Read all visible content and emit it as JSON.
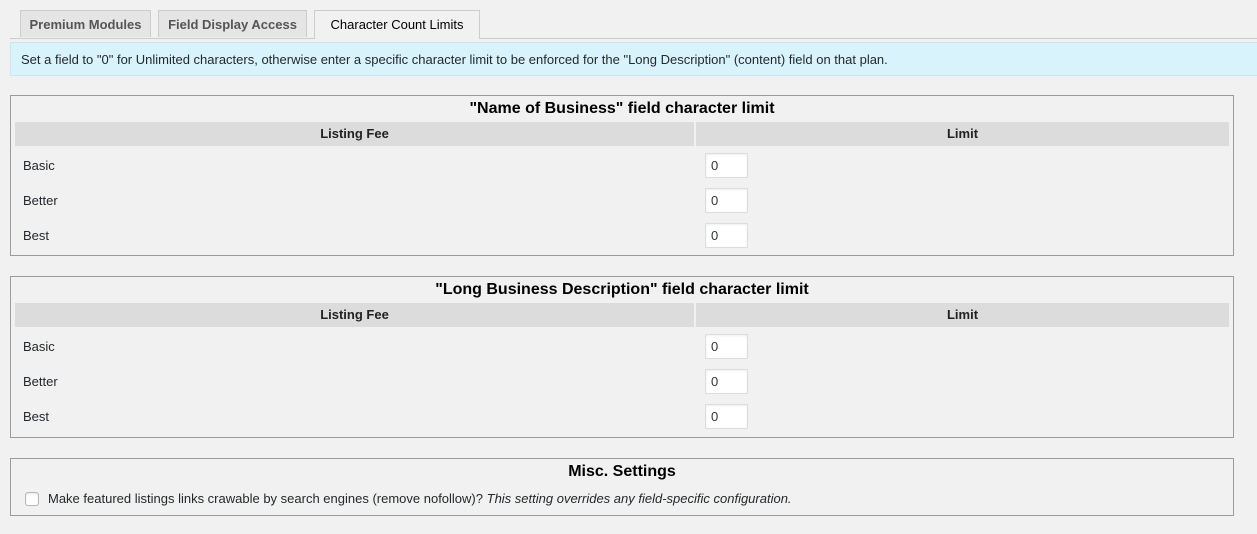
{
  "tabs": [
    {
      "label": "Premium Modules",
      "active": false
    },
    {
      "label": "Field Display Access",
      "active": false
    },
    {
      "label": "Character Count Limits",
      "active": true
    }
  ],
  "notice": {
    "text": "Set a field to \"0\" for Unlimited characters, otherwise enter a specific character limit to be enforced for the \"Long Description\" (content) field on that plan."
  },
  "name_section": {
    "title": "\"Name of Business\" field character limit",
    "header_fee": "Listing Fee",
    "header_limit": "Limit",
    "rows": [
      {
        "label": "Basic",
        "value": "0"
      },
      {
        "label": "Better",
        "value": "0"
      },
      {
        "label": "Best",
        "value": "0"
      }
    ]
  },
  "desc_section": {
    "title": "\"Long Business Description\" field character limit",
    "header_fee": "Listing Fee",
    "header_limit": "Limit",
    "rows": [
      {
        "label": "Basic",
        "value": "0"
      },
      {
        "label": "Better",
        "value": "0"
      },
      {
        "label": "Best",
        "value": "0"
      }
    ]
  },
  "misc": {
    "title": "Misc. Settings",
    "checkbox_label": "Make featured listings links crawable by search engines (remove nofollow)?",
    "checkbox_note": "This setting overrides any field-specific configuration.",
    "checked": false
  },
  "colors": {
    "notice_bg": "#d9f3fd",
    "header_bg": "#dcdcdc",
    "page_bg": "#f1f1f1"
  }
}
